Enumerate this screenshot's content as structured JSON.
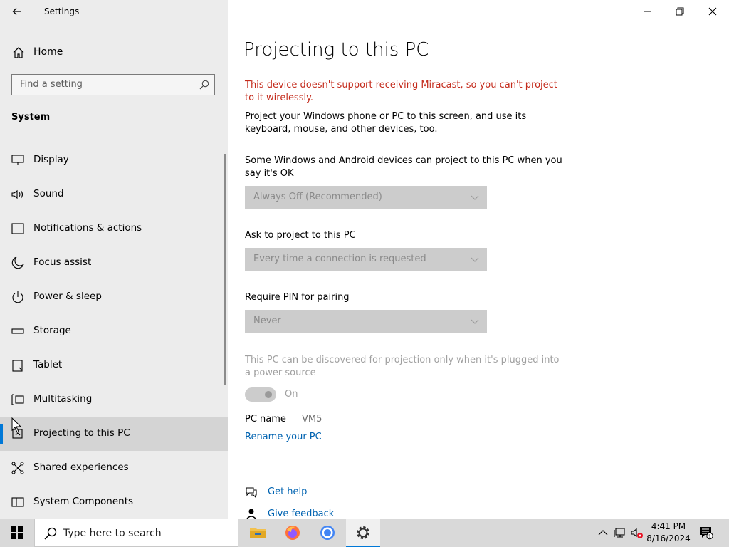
{
  "window": {
    "app_title": "Settings"
  },
  "sidebar": {
    "home_label": "Home",
    "search_placeholder": "Find a setting",
    "section_label": "System",
    "items": [
      {
        "label": "Display"
      },
      {
        "label": "Sound"
      },
      {
        "label": "Notifications & actions"
      },
      {
        "label": "Focus assist"
      },
      {
        "label": "Power & sleep"
      },
      {
        "label": "Storage"
      },
      {
        "label": "Tablet"
      },
      {
        "label": "Multitasking"
      },
      {
        "label": "Projecting to this PC"
      },
      {
        "label": "Shared experiences"
      },
      {
        "label": "System Components"
      }
    ]
  },
  "main": {
    "title": "Projecting to this PC",
    "warning": "This device doesn't support receiving Miracast, so you can't project to it wirelessly.",
    "description": "Project your Windows phone or PC to this screen, and use its keyboard, mouse, and other devices, too.",
    "setting1_label": "Some Windows and Android devices can project to this PC when you say it's OK",
    "setting1_value": "Always Off (Recommended)",
    "setting2_label": "Ask to project to this PC",
    "setting2_value": "Every time a connection is requested",
    "setting3_label": "Require PIN for pairing",
    "setting3_value": "Never",
    "power_note": "This PC can be discovered for projection only when it's plugged into a power source",
    "toggle_label": "On",
    "pc_name_label": "PC name",
    "pc_name_value": "VM5",
    "rename_link": "Rename your PC",
    "get_help": "Get help",
    "give_feedback": "Give feedback"
  },
  "taskbar": {
    "search_placeholder": "Type here to search",
    "time": "4:41 PM",
    "date": "8/16/2024",
    "notification_count": "1"
  },
  "colors": {
    "accent": "#0078d7",
    "warning": "#c42b1c",
    "link": "#0063b1",
    "sidebar_bg": "#ececec"
  }
}
